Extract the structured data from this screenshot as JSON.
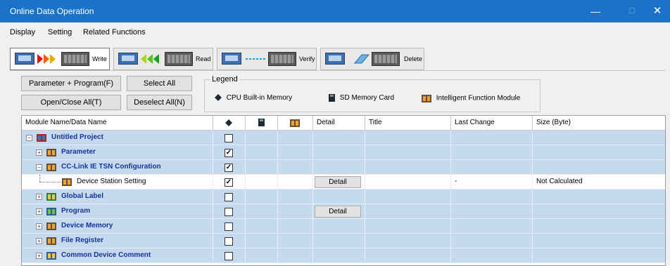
{
  "window": {
    "title": "Online Data Operation",
    "minimize": "—",
    "maximize": "☐",
    "close": "✕"
  },
  "menu": [
    "Display",
    "Setting",
    "Related Functions"
  ],
  "operation_tabs": [
    {
      "label": "Write",
      "active": true
    },
    {
      "label": "Read",
      "active": false
    },
    {
      "label": "Verify",
      "active": false
    },
    {
      "label": "Delete",
      "active": false
    }
  ],
  "buttons": {
    "parameter_program": "Parameter + Program(F)",
    "select_all": "Select All",
    "open_close_all": "Open/Close All(T)",
    "deselect_all": "Deselect All(N)"
  },
  "legend": {
    "title": "Legend",
    "items": [
      {
        "label": "CPU Built-in Memory",
        "icon": "cpu-memory-icon"
      },
      {
        "label": "SD Memory Card",
        "icon": "sd-card-icon"
      },
      {
        "label": "Intelligent Function Module",
        "icon": "intelligent-module-icon"
      }
    ]
  },
  "table": {
    "headers": [
      "Module Name/Data Name",
      "",
      "",
      "",
      "Detail",
      "Title",
      "Last Change",
      "Size (Byte)"
    ],
    "header_icons": [
      "cpu-memory-icon",
      "sd-card-icon",
      "intelligent-module-icon"
    ],
    "rows": [
      {
        "name": "Untitled Project",
        "level": 0,
        "expand": "−",
        "icon": "project-icon",
        "checked": false,
        "detail": "",
        "title": "",
        "last_change": "",
        "size": "",
        "selected": false
      },
      {
        "name": "Parameter",
        "level": 1,
        "expand": "+",
        "icon": "parameter-icon",
        "checked": true,
        "detail": "",
        "title": "",
        "last_change": "",
        "size": "",
        "selected": false
      },
      {
        "name": "CC-Link IE TSN Configuration",
        "level": 1,
        "expand": "−",
        "icon": "network-config-icon",
        "checked": true,
        "detail": "",
        "title": "",
        "last_change": "",
        "size": "",
        "selected": false
      },
      {
        "name": "Device Station Setting",
        "level": 2,
        "expand": "",
        "icon": "device-station-icon",
        "checked": true,
        "detail": "Detail",
        "title": "",
        "last_change": "-",
        "size": "Not Calculated",
        "selected": true
      },
      {
        "name": "Global Label",
        "level": 1,
        "expand": "+",
        "icon": "global-label-icon",
        "checked": false,
        "detail": "",
        "title": "",
        "last_change": "",
        "size": "",
        "selected": false
      },
      {
        "name": "Program",
        "level": 1,
        "expand": "+",
        "icon": "program-icon",
        "checked": false,
        "detail": "Detail",
        "title": "",
        "last_change": "",
        "size": "",
        "selected": false
      },
      {
        "name": "Device Memory",
        "level": 1,
        "expand": "+",
        "icon": "device-memory-icon",
        "checked": false,
        "detail": "",
        "title": "",
        "last_change": "",
        "size": "",
        "selected": false
      },
      {
        "name": "File Register",
        "level": 1,
        "expand": "+",
        "icon": "file-register-icon",
        "checked": false,
        "detail": "",
        "title": "",
        "last_change": "",
        "size": "",
        "selected": false
      },
      {
        "name": "Common Device Comment",
        "level": 1,
        "expand": "+",
        "icon": "device-comment-icon",
        "checked": false,
        "detail": "",
        "title": "",
        "last_change": "",
        "size": "",
        "selected": false
      }
    ]
  }
}
